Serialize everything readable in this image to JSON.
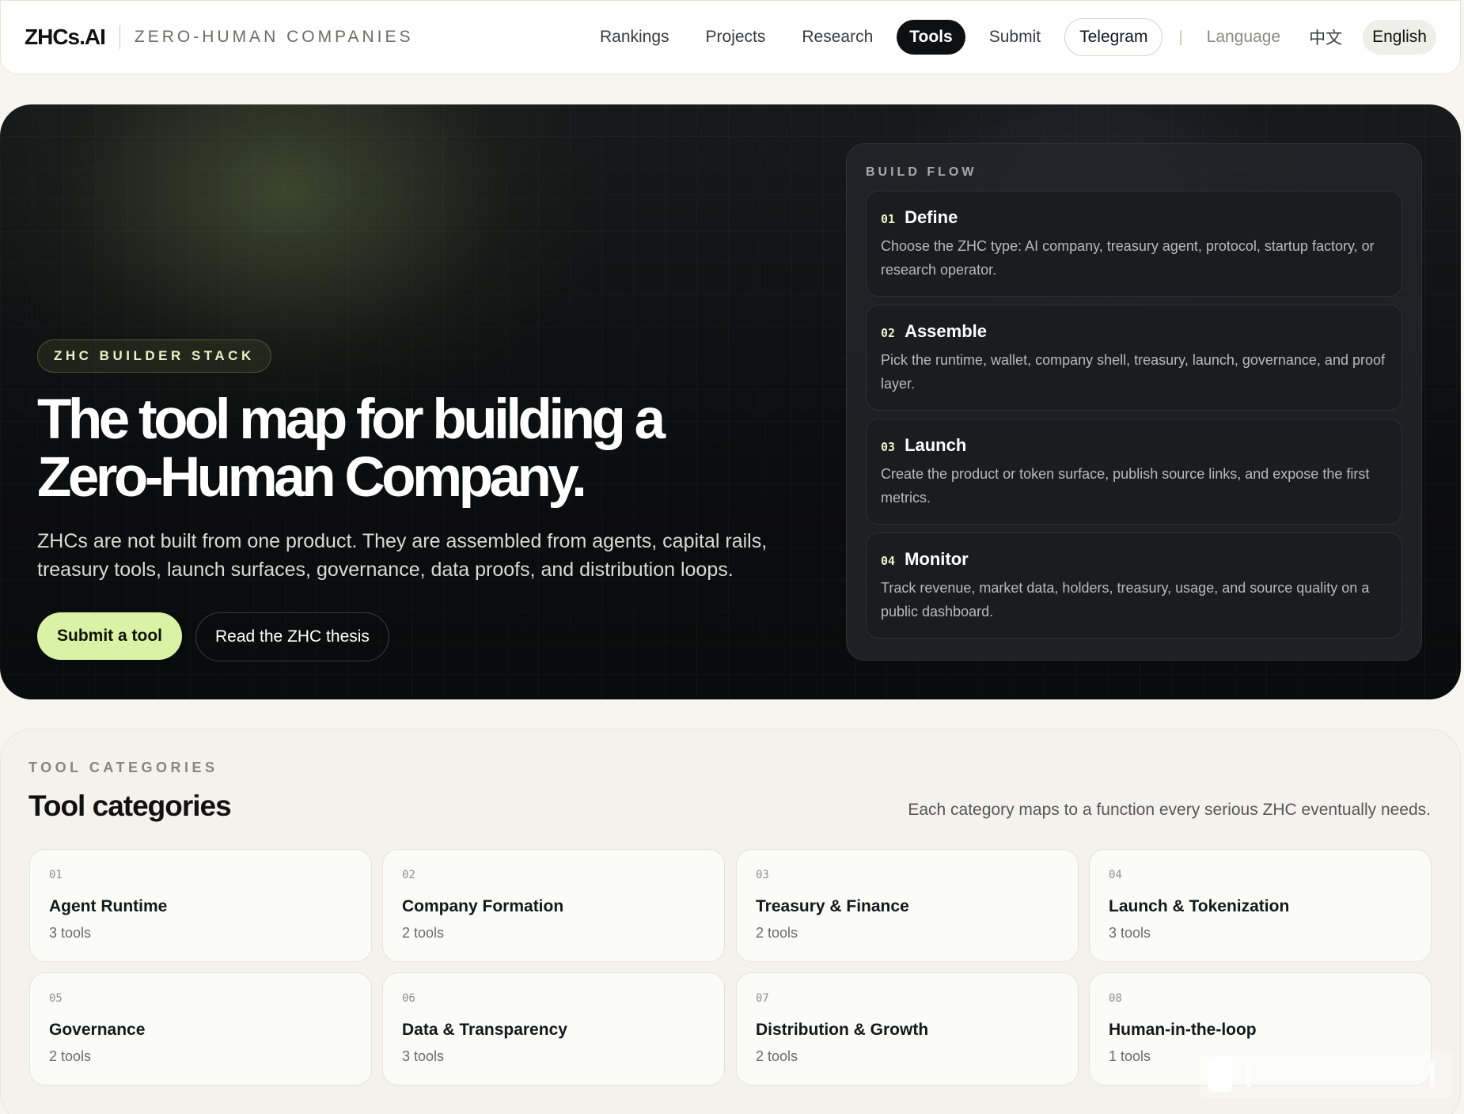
{
  "nav": {
    "logo": "ZHCs.AI",
    "tagline": "ZERO-HUMAN COMPANIES",
    "links": [
      {
        "label": "Rankings"
      },
      {
        "label": "Projects"
      },
      {
        "label": "Research"
      },
      {
        "label": "Tools",
        "active": true
      },
      {
        "label": "Submit"
      }
    ],
    "telegram": "Telegram",
    "separator": "|",
    "language_label": "Language",
    "lang_zh": "中文",
    "lang_en": "English"
  },
  "hero": {
    "eyebrow": "ZHC BUILDER STACK",
    "title": "The tool map for building a Zero-Human Company.",
    "description": "ZHCs are not built from one product. They are assembled from agents, capital rails, treasury tools, launch surfaces, governance, data proofs, and distribution loops.",
    "primary_button": "Submit a tool",
    "secondary_button": "Read the ZHC thesis"
  },
  "build_flow": {
    "label": "BUILD FLOW",
    "steps": [
      {
        "num": "01",
        "title": "Define",
        "body": "Choose the ZHC type: AI company, treasury agent, protocol, startup factory, or research operator."
      },
      {
        "num": "02",
        "title": "Assemble",
        "body": "Pick the runtime, wallet, company shell, treasury, launch, governance, and proof layer."
      },
      {
        "num": "03",
        "title": "Launch",
        "body": "Create the product or token surface, publish source links, and expose the first metrics."
      },
      {
        "num": "04",
        "title": "Monitor",
        "body": "Track revenue, market data, holders, treasury, usage, and source quality on a public dashboard."
      }
    ]
  },
  "categories": {
    "eyebrow": "TOOL CATEGORIES",
    "title": "Tool categories",
    "subtitle": "Each category maps to a function every serious ZHC eventually needs.",
    "items": [
      {
        "num": "01",
        "title": "Agent Runtime",
        "count": "3 tools"
      },
      {
        "num": "02",
        "title": "Company Formation",
        "count": "2 tools"
      },
      {
        "num": "03",
        "title": "Treasury & Finance",
        "count": "2 tools"
      },
      {
        "num": "04",
        "title": "Launch & Tokenization",
        "count": "3 tools"
      },
      {
        "num": "05",
        "title": "Governance",
        "count": "2 tools"
      },
      {
        "num": "06",
        "title": "Data & Transparency",
        "count": "3 tools"
      },
      {
        "num": "07",
        "title": "Distribution & Growth",
        "count": "2 tools"
      },
      {
        "num": "08",
        "title": "Human-in-the-loop",
        "count": "1 tools"
      }
    ]
  },
  "colors": {
    "accent": "#d9f2a6",
    "hero_bg": "#0c0d0e",
    "page_bg": "#f6f5ef"
  }
}
